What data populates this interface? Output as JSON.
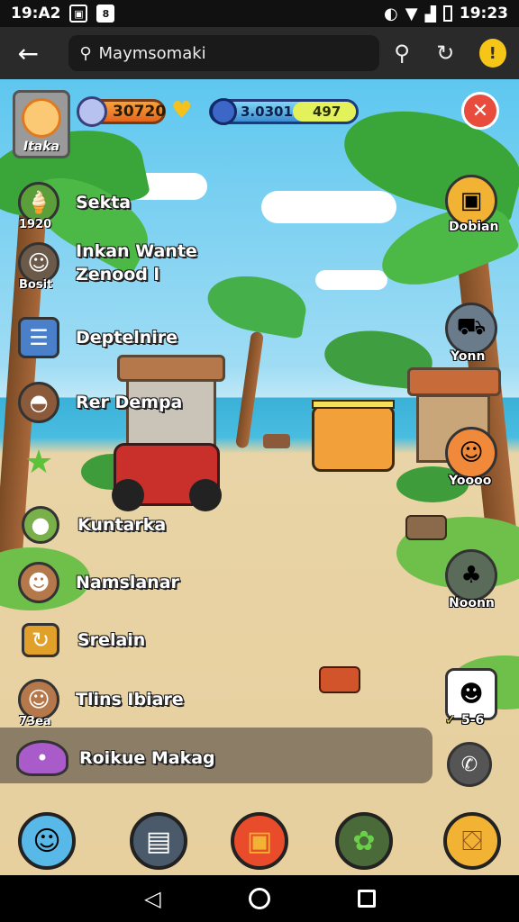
{
  "status_bar": {
    "time_left": "19:A2",
    "time_right": "19:23"
  },
  "app_bar": {
    "search_text": "Maymsomaki"
  },
  "hud": {
    "profile_name": "Itaka",
    "coins": "30720",
    "gems": "3.0301",
    "gems_secondary": "497"
  },
  "menu": [
    {
      "label": "Sekta",
      "badge": "1920",
      "icon": "ice-cream-icon",
      "color": "#5b9f3a"
    },
    {
      "label": "Inkan Wante",
      "label2": "Zenood l",
      "badge": "Bosit",
      "icon": "villager-icon",
      "color": "#6b5a4a"
    },
    {
      "label": "Deptelnire",
      "badge": "",
      "icon": "notebook-icon",
      "color": "#4a7fc9"
    },
    {
      "label": "Rer Dempa",
      "badge": "",
      "icon": "food-bowl-icon",
      "color": "#8a5a3a"
    },
    {
      "label": "",
      "badge": "",
      "icon": "star-icon",
      "color": "#3aa63a"
    },
    {
      "label": "Kuntarka",
      "badge": "",
      "icon": "ball-icon",
      "color": "#7ab04a"
    },
    {
      "label": "Namslanar",
      "badge": "",
      "icon": "girl-character-icon",
      "color": "#b5784a"
    },
    {
      "label": "Srelain",
      "badge": "",
      "icon": "rotate-box-icon",
      "color": "#e0a02a"
    },
    {
      "label": "Tlins Ibiare",
      "badge": "73ea",
      "icon": "boy-character-icon",
      "color": "#b5784a"
    },
    {
      "label": "Roikue Makag",
      "badge": "",
      "icon": "slime-icon",
      "color": "#a85bc9"
    }
  ],
  "right_buttons": [
    {
      "label": "Dobian",
      "icon": "crate-icon",
      "color": "#f2b233"
    },
    {
      "label": "Yonn",
      "icon": "cart-icon",
      "color": "#6a7b8c"
    },
    {
      "label": "Yoooo",
      "icon": "builder-icon",
      "color": "#f08a3a"
    },
    {
      "label": "Noonn",
      "icon": "tree-icon",
      "color": "#5a6b5a"
    },
    {
      "label": "5-6",
      "label_prefix": "✓",
      "icon": "shop-card-icon",
      "color": "#ffffff"
    },
    {
      "label": "",
      "icon": "phone-icon",
      "color": "#555555"
    }
  ],
  "dock": [
    {
      "icon": "mascot-icon",
      "color": "#58b8e8"
    },
    {
      "icon": "inventory-box-icon",
      "color": "#4a5a6a"
    },
    {
      "icon": "crate-red-icon",
      "color": "#e84c2a"
    },
    {
      "icon": "gear-icon",
      "color": "#4a6a3a"
    },
    {
      "icon": "basket-icon",
      "color": "#f2b233"
    }
  ]
}
